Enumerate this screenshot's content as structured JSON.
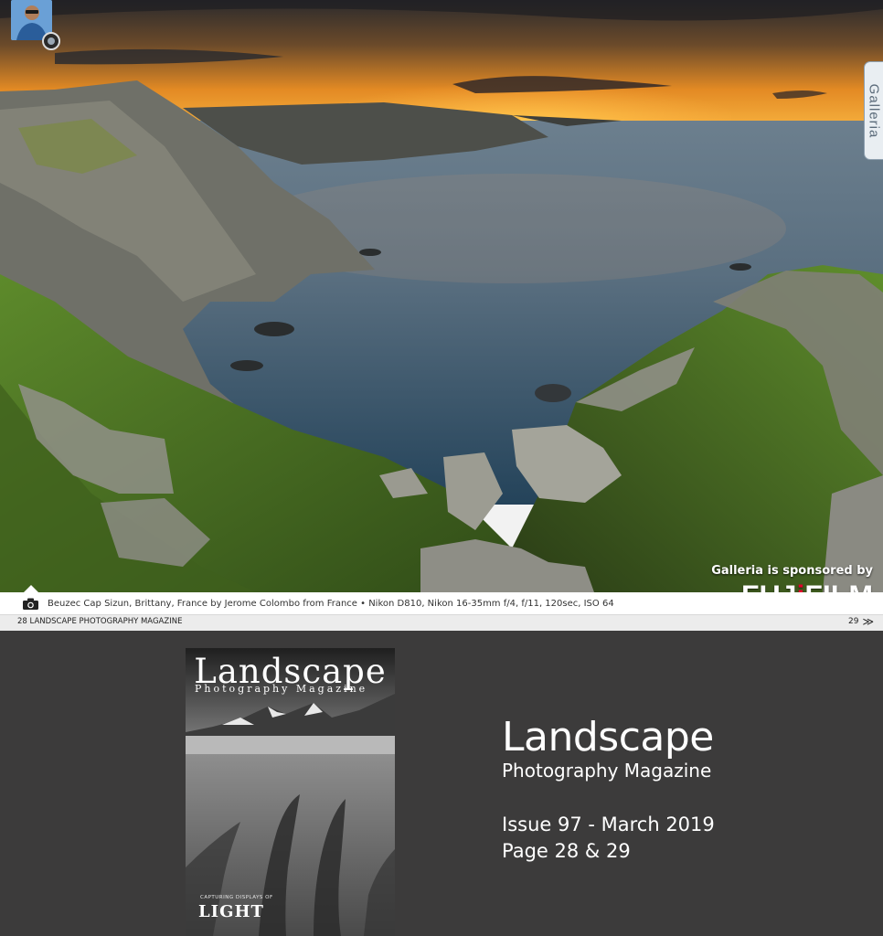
{
  "spread": {
    "galleria_tab_label": "Galleria",
    "sponsor_text": "Galleria is sponsored by",
    "sponsor_logo_pre": "FUJ",
    "sponsor_logo_dot": "i",
    "sponsor_logo_post": "FILM",
    "caption": "Beuzec Cap Sizun, Brittany, France by Jerome Colombo from France • Nikon D810, Nikon 16-35mm f/4, f/11, 120sec, ISO 64",
    "footer_left": "28 LANDSCAPE PHOTOGRAPHY MAGAZINE",
    "footer_right_page": "29",
    "footer_right_chevron": "≫"
  },
  "cover": {
    "title": "Landscape",
    "subtitle": "Photography Magazine",
    "tagline": "CAPTURING DISPLAYS OF",
    "headline": "LIGHT"
  },
  "magazine": {
    "title": "Landscape",
    "subtitle": "Photography Magazine",
    "issue": "Issue 97 - March 2019",
    "pages": "Page 28 & 29"
  },
  "colors": {
    "page_background": "#3c3b3b",
    "fujifilm_red": "#e4002b",
    "sunset_orange": "#f0a23a"
  },
  "icons": [
    "camera-icon",
    "home-icon",
    "chevron-double-right-icon",
    "photographer-avatar"
  ]
}
